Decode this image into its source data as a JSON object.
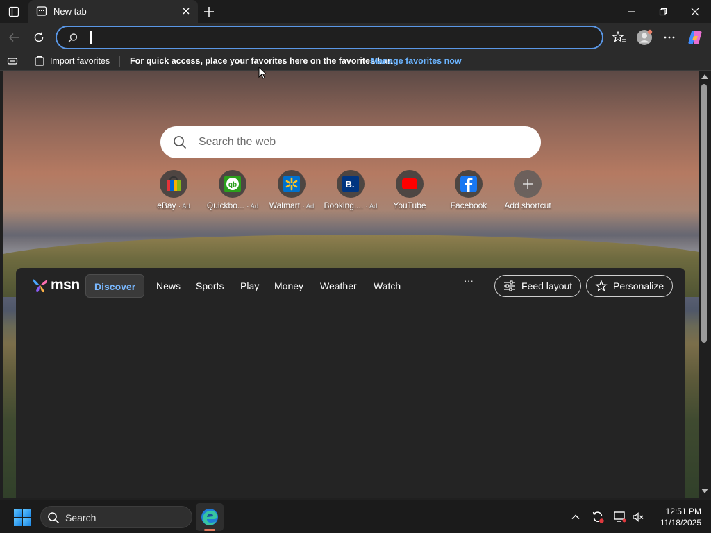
{
  "browser": {
    "tab": {
      "title": "New tab"
    },
    "address": {
      "value": "",
      "placeholder": ""
    },
    "favorites_bar": {
      "import_label": "Import favorites",
      "hint": "For quick access, place your favorites here on the favorites bar.",
      "manage_link": "Manage favorites now"
    }
  },
  "newtab": {
    "search_placeholder": "Search the web",
    "shortcuts": [
      {
        "label": "eBay",
        "ad": "· Ad",
        "icon": "ebay-icon"
      },
      {
        "label": "Quickbo...",
        "ad": "· Ad",
        "icon": "quickbooks-icon"
      },
      {
        "label": "Walmart",
        "ad": "· Ad",
        "icon": "walmart-icon"
      },
      {
        "label": "Booking....",
        "ad": "· Ad",
        "icon": "booking-icon"
      },
      {
        "label": "YouTube",
        "ad": "",
        "icon": "youtube-icon"
      },
      {
        "label": "Facebook",
        "ad": "",
        "icon": "facebook-icon"
      },
      {
        "label": "Add shortcut",
        "ad": "",
        "icon": "plus-icon"
      }
    ]
  },
  "feed": {
    "logo_text": "msn",
    "nav": [
      "Discover",
      "News",
      "Sports",
      "Play",
      "Money",
      "Weather",
      "Watch"
    ],
    "active_nav": "Discover",
    "more": "···",
    "feed_layout_label": "Feed layout",
    "personalize_label": "Personalize"
  },
  "taskbar": {
    "search_label": "Search",
    "time": "12:51 PM",
    "date": "11/18/2025"
  },
  "colors": {
    "accent": "#5a97e6",
    "link": "#6bb4ff",
    "active_nav": "#79b8ff"
  }
}
